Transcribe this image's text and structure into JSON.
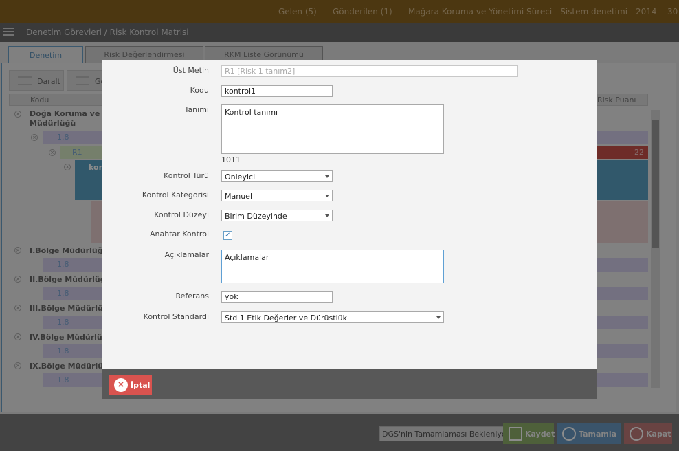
{
  "topbar": {
    "gelen": "Gelen (5)",
    "gonderilen": "Gönderilen (1)",
    "process": "Mağara Koruma ve Yönetimi Süreci - Sistem denetimi - 2014",
    "extra": "30"
  },
  "titlebar": {
    "breadcrumb": "Denetim Görevleri / Risk Kontrol Matrisi"
  },
  "tabs": [
    "Denetim",
    "Risk Değerlendirmesi",
    "RKM Liste Görünümü"
  ],
  "toolbar": {
    "collapse": "Daralt",
    "expand": "Ge"
  },
  "grid": {
    "col_kodu": "Kodu",
    "col_risk": "Risk Puanı",
    "root": "Doğa Koruma ve N",
    "root2": "Müdürlüğü",
    "r1_code": "1.8",
    "risk_code": "R1",
    "risk_score": "22",
    "kon": "kon",
    "regions": [
      "I.Bölge Müdürlüğ",
      "II.Bölge Müdürlüğ",
      "III.Bölge Müdürlü",
      "IV.Bölge Müdürlü",
      "IX.Bölge Müdürlü"
    ],
    "region_code": "1.8"
  },
  "bottombar": {
    "status": "DGS'nin Tamamlaması Bekleniyor",
    "save": "Kaydet",
    "complete": "Tamamla",
    "close": "Kapat"
  },
  "modal": {
    "ust_metin_label": "Üst Metin",
    "ust_metin_value": "R1 [Risk 1 tanım2]",
    "kodu_label": "Kodu",
    "kodu_value": "kontrol1",
    "tanimi_label": "Tanımı",
    "tanimi_value": "Kontrol tanımı",
    "char_count": "1011",
    "tur_label": "Kontrol Türü",
    "tur_value": "Önleyici",
    "kategori_label": "Kontrol Kategorisi",
    "kategori_value": "Manuel",
    "duzey_label": "Kontrol Düzeyi",
    "duzey_value": "Birim Düzeyinde",
    "anahtar_label": "Anahtar Kontrol",
    "aciklama_label": "Açıklamalar",
    "aciklama_value": "Açıklamalar",
    "referans_label": "Referans",
    "referans_value": "yok",
    "standart_label": "Kontrol Standardı",
    "standart_value": "Std 1 Etik Değerler ve Dürüstlük",
    "cancel": "İptal"
  }
}
